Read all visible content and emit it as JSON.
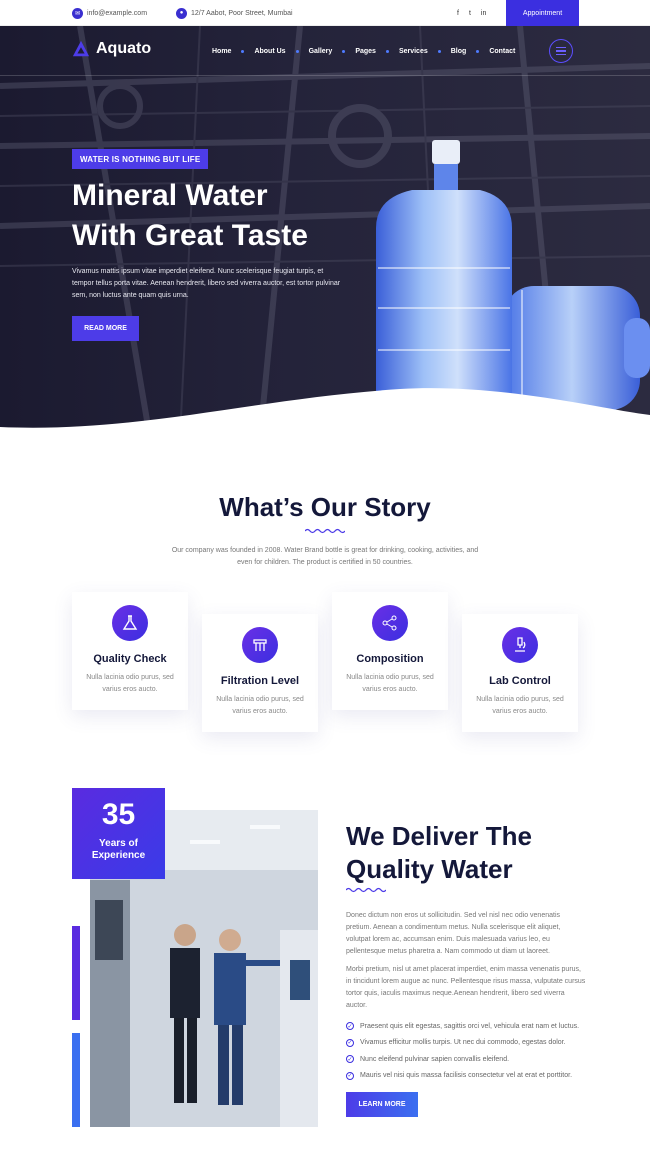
{
  "topbar": {
    "email": "info@example.com",
    "address": "12/7 Aabot, Poor Street, Mumbai",
    "social": [
      "f",
      "t",
      "in"
    ],
    "appointment_label": "Appointment"
  },
  "nav": {
    "logo": "Aquato",
    "links": [
      "Home",
      "About Us",
      "Gallery",
      "Pages",
      "Services",
      "Blog",
      "Contact"
    ]
  },
  "hero": {
    "tagline": "WATER IS NOTHING BUT LIFE",
    "title_line1": "Mineral Water",
    "title_line2": "With Great Taste",
    "text": "Vivamus mattis ipsum vitae imperdiet eleifend. Nunc scelerisque feugiat turpis, et tempor tellus porta vitae. Aenean hendrerit, libero sed viverra auctor, est tortor pulvinar sem, non luctus ante quam quis urna.",
    "button": "READ MORE"
  },
  "story": {
    "title": "What’s Our Story",
    "text": "Our company was founded in 2008. Water Brand bottle is great for drinking, cooking, activities, and even for children. The product is certified in 50 countries.",
    "cards": [
      {
        "title": "Quality Check",
        "desc": "Nulla lacinia odio purus, sed varius eros aucto.",
        "icon": "flask-icon"
      },
      {
        "title": "Filtration Level",
        "desc": "Nulla lacinia odio purus, sed varius eros aucto.",
        "icon": "filter-icon"
      },
      {
        "title": "Composition",
        "desc": "Nulla lacinia odio purus, sed varius eros aucto.",
        "icon": "molecule-icon"
      },
      {
        "title": "Lab Control",
        "desc": "Nulla lacinia odio purus, sed varius eros aucto.",
        "icon": "microscope-icon"
      }
    ]
  },
  "deliver": {
    "experience_number": "35",
    "experience_label_line1": "Years of",
    "experience_label_line2": "Experience",
    "title_line1": "We Deliver The",
    "title_line2": "Quality Water",
    "para1": "Donec dictum non eros ut sollicitudin. Sed vel nisl nec odio venenatis pretium. Aenean a condimentum metus. Nulla scelerisque elit aliquet, volutpat lorem ac, accumsan enim. Duis malesuada varius leo, eu pellentesque metus pharetra a. Nam commodo ut diam ut laoreet.",
    "para2": "Morbi pretium, nisl ut amet placerat imperdiet, enim massa venenatis purus, in tincidunt lorem augue ac nunc. Pellentesque risus massa, vulputate cursus tortor quis, iaculis maximus neque.Aenean hendrerit, libero sed viverra auctor.",
    "checks": [
      "Praesent quis elit egestas, sagittis orci vel, vehicula erat nam et luctus.",
      "Vivamus efficitur mollis turpis. Ut nec dui commodo, egestas dolor.",
      "Nunc eleifend pulvinar sapien convallis eleifend.",
      "Mauris vel nisi quis massa facilisis consectetur vel at erat et porttitor."
    ],
    "button": "LEARN MORE"
  },
  "colors": {
    "accent": "#3b2fe0",
    "accent_blue": "#3a6ff0",
    "hero_bg": "#1f1e34",
    "heading": "#14183a"
  }
}
